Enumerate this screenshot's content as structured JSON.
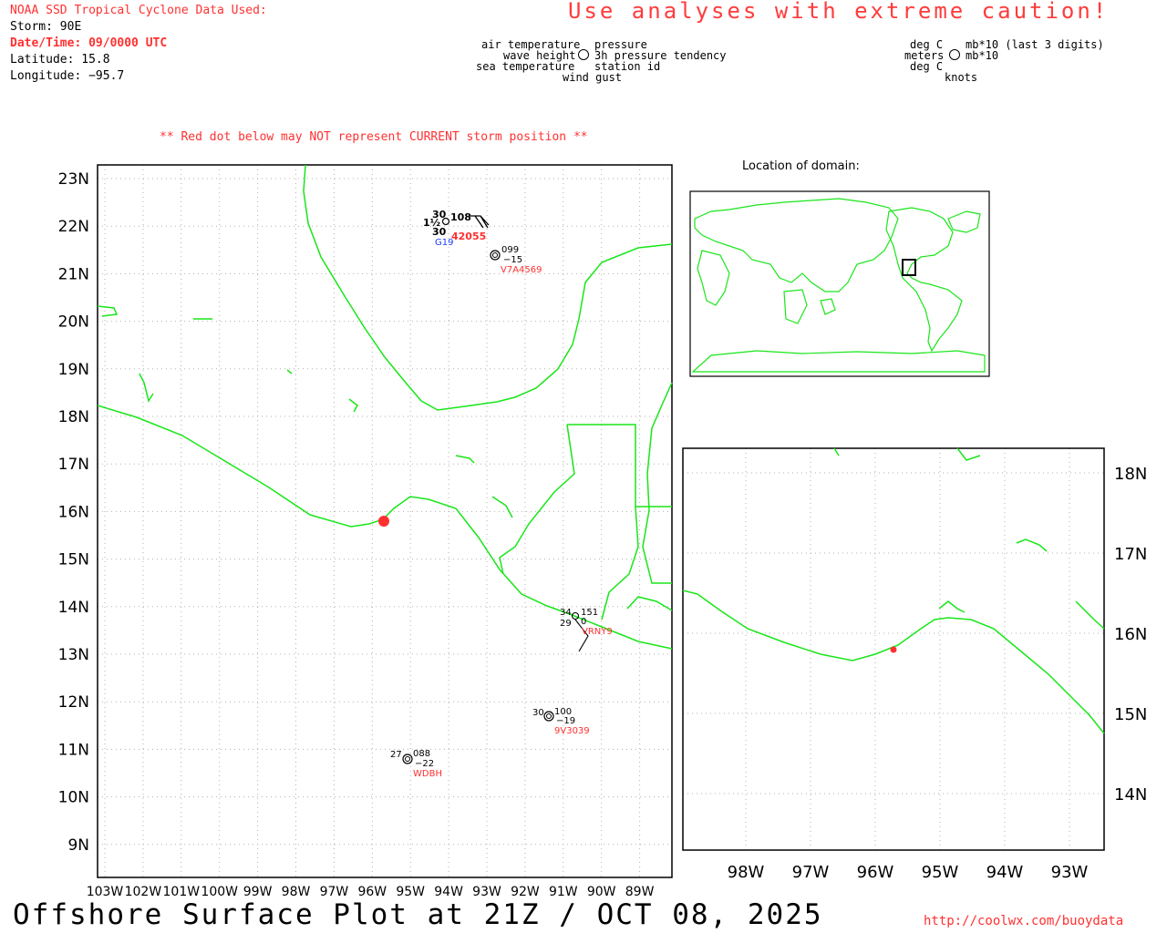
{
  "header": {
    "source": "NOAA SSD Tropical Cyclone Data Used:",
    "storm": "Storm: 90E",
    "datetime": "Date/Time: 09/0000 UTC",
    "latitude": "Latitude: 15.8",
    "longitude": "Longitude: −95.7",
    "caution": "Use analyses with extreme caution!"
  },
  "legend": {
    "left": {
      "air_temperature": "air temperature",
      "pressure": "pressure",
      "wave_height": "wave height",
      "tendency": "3h pressure tendency",
      "sea_temperature": "sea temperature",
      "station_id": "station id",
      "wind_gust": "wind gust"
    },
    "right": {
      "deg_c_1": "deg C",
      "mb_last3": "mb*10 (last 3 digits)",
      "meters": "meters",
      "mb10": "mb*10",
      "deg_c_2": "deg C",
      "knots": "knots"
    }
  },
  "warning": "** Red dot below may NOT represent CURRENT storm position **",
  "main_map": {
    "lat_labels": [
      "23N",
      "22N",
      "21N",
      "20N",
      "19N",
      "18N",
      "17N",
      "16N",
      "15N",
      "14N",
      "13N",
      "12N",
      "11N",
      "10N",
      "9N"
    ],
    "lon_labels": [
      "103W",
      "102W",
      "101W",
      "100W",
      "99W",
      "98W",
      "97W",
      "96W",
      "95W",
      "94W",
      "93W",
      "92W",
      "91W",
      "90W",
      "89W"
    ],
    "storm_position": {
      "lat": 15.8,
      "lon": -95.7
    },
    "stations": [
      {
        "id": "42055",
        "air": "30",
        "wave": "1½",
        "sea": "30",
        "pressure": "108",
        "gust_label": "G19"
      },
      {
        "id": "V7A4569",
        "pressure": "099",
        "tendency": "−15"
      },
      {
        "id": "VRNY9",
        "air": "34",
        "sea": "29",
        "pressure": "151",
        "tendency": "0"
      },
      {
        "id": "9V3039",
        "air": "30",
        "pressure": "100",
        "tendency": "−19"
      },
      {
        "id": "WDBH",
        "air": "27",
        "pressure": "088",
        "tendency": "−22"
      }
    ]
  },
  "inset": {
    "title": "Location of domain:"
  },
  "zoom_map": {
    "lat_labels": [
      "18N",
      "17N",
      "16N",
      "15N",
      "14N"
    ],
    "lon_labels": [
      "98W",
      "97W",
      "96W",
      "95W",
      "94W",
      "93W"
    ]
  },
  "footer": {
    "title": "Offshore Surface Plot at 21Z / OCT 08, 2025",
    "url": "http://coolwx.com/buoydata"
  },
  "colors": {
    "coast": "#19e619",
    "accent": "#ff3030",
    "blue": "#1a3cff"
  }
}
